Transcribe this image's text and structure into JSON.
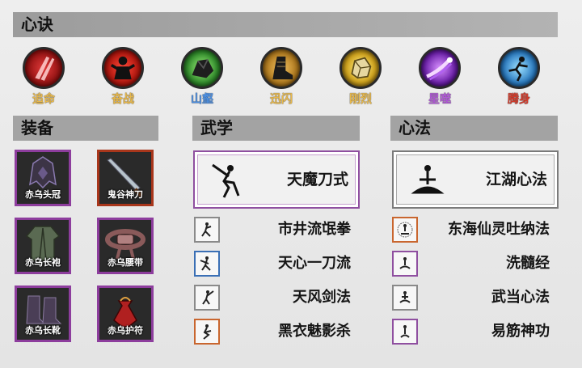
{
  "sections": {
    "xinjue_title": "心诀",
    "equip_title": "装备",
    "wuxue_title": "武学",
    "xinfa_title": "心法"
  },
  "skills": [
    {
      "label": "追命",
      "color": "#e8b84a",
      "icon": "red-slash-icon"
    },
    {
      "label": "奋战",
      "color": "#e8b84a",
      "icon": "red-warrior-icon"
    },
    {
      "label": "山壑",
      "color": "#4d8fe0",
      "icon": "green-rock-icon"
    },
    {
      "label": "迅闪",
      "color": "#e8b84a",
      "icon": "boot-icon"
    },
    {
      "label": "刚烈",
      "color": "#e8b84a",
      "icon": "gold-rock-icon"
    },
    {
      "label": "星噬",
      "color": "#b05ad6",
      "icon": "purple-comet-icon"
    },
    {
      "label": "腾身",
      "color": "#d23a2a",
      "icon": "blue-leap-icon"
    }
  ],
  "equipment": [
    {
      "name": "赤乌头冠",
      "icon": "helmet-icon",
      "rarity_color": "#8d3d9d"
    },
    {
      "name": "鬼谷神刀",
      "icon": "blade-icon",
      "rarity_color": "#a8361b"
    },
    {
      "name": "赤乌长袍",
      "icon": "robe-icon",
      "rarity_color": "#8d3d9d"
    },
    {
      "name": "赤乌腰带",
      "icon": "belt-icon",
      "rarity_color": "#8d3d9d"
    },
    {
      "name": "赤乌长靴",
      "icon": "boots-icon",
      "rarity_color": "#8d3d9d"
    },
    {
      "name": "赤乌护符",
      "icon": "amulet-pouch-icon",
      "rarity_color": "#8d3d9d"
    }
  ],
  "wuxue": {
    "featured": "天魔刀式",
    "list": [
      {
        "name": "市井流氓拳",
        "frame": "grey"
      },
      {
        "name": "天心一刀流",
        "frame": "blue"
      },
      {
        "name": "天风剑法",
        "frame": "grey"
      },
      {
        "name": "黑衣魅影杀",
        "frame": "orange"
      }
    ]
  },
  "xinfa": {
    "featured": "江湖心法",
    "list": [
      {
        "name": "东海仙灵吐纳法",
        "frame": "orange"
      },
      {
        "name": "洗髓经",
        "frame": "purple"
      },
      {
        "name": "武当心法",
        "frame": "grey"
      },
      {
        "name": "易筋神功",
        "frame": "purple"
      }
    ]
  }
}
